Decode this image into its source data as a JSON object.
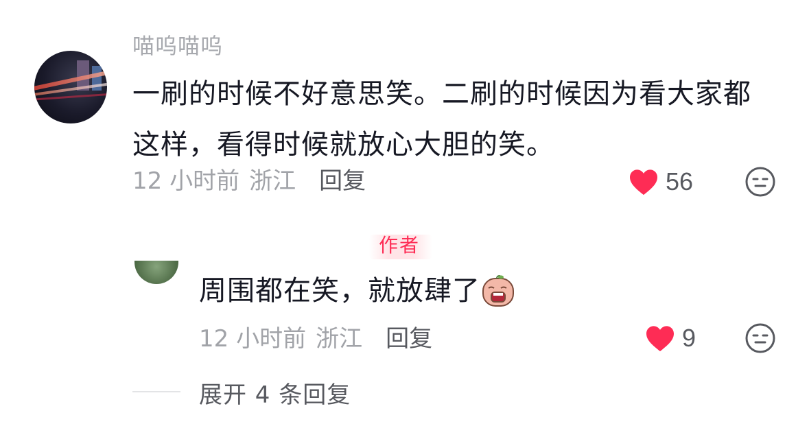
{
  "comment": {
    "username": "喵呜喵呜",
    "text": "一刷的时候不好意思笑。二刷的时候因为看大家都这样，看得时候就放心大胆的笑。",
    "time": "12 小时前",
    "region": "浙江",
    "reply_label": "回复",
    "likes": "56"
  },
  "reply": {
    "author_badge": "作者",
    "text": "周围都在笑，就放肆了",
    "time": "12 小时前",
    "region": "浙江",
    "reply_label": "回复",
    "likes": "9"
  },
  "expand": {
    "label": "展开 4 条回复"
  },
  "colors": {
    "heart": "#fe2c55",
    "text_primary": "#161823",
    "text_secondary": "#a1a3a8",
    "action": "#57595f"
  }
}
